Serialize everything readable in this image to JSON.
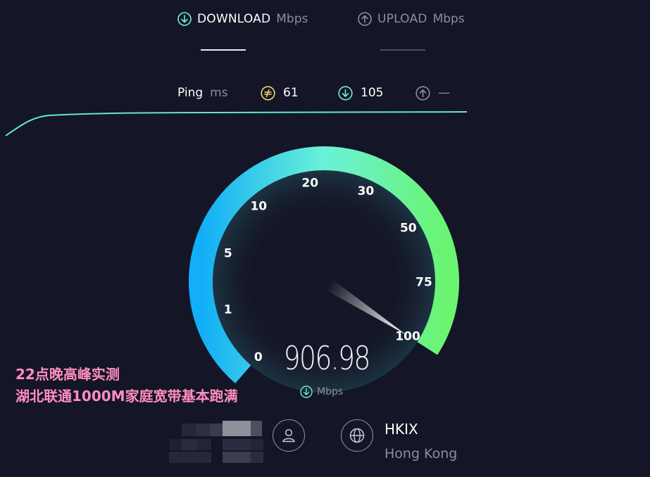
{
  "tabs": {
    "download": {
      "label": "DOWNLOAD",
      "unit": "Mbps",
      "icon": "arrow-down-circle-icon",
      "active": true
    },
    "upload": {
      "label": "UPLOAD",
      "unit": "Mbps",
      "icon": "arrow-up-circle-icon",
      "active": false
    }
  },
  "ping": {
    "label": "Ping",
    "unit": "ms",
    "idle": "61",
    "download": "105",
    "upload": "—",
    "icons": [
      "idle-latency-icon",
      "arrow-down-circle-icon",
      "arrow-up-circle-icon"
    ]
  },
  "gauge": {
    "scale_labels": [
      "0",
      "1",
      "5",
      "10",
      "20",
      "30",
      "50",
      "75",
      "100"
    ],
    "needle_scale_value": 100,
    "colors": {
      "arc_start": "#18b4f5",
      "arc_mid": "#6af1d8",
      "arc_end": "#6af470",
      "idle_color": "#f7d56b",
      "download_color": "#6ef0d7"
    }
  },
  "result": {
    "speed": "906.98",
    "unit": "Mbps"
  },
  "caption": {
    "line1": "22点晚高峰实测",
    "line2": "湖北联通1000M家庭宽带基本跑满"
  },
  "server": {
    "name": "HKIX",
    "location": "Hong Kong"
  }
}
